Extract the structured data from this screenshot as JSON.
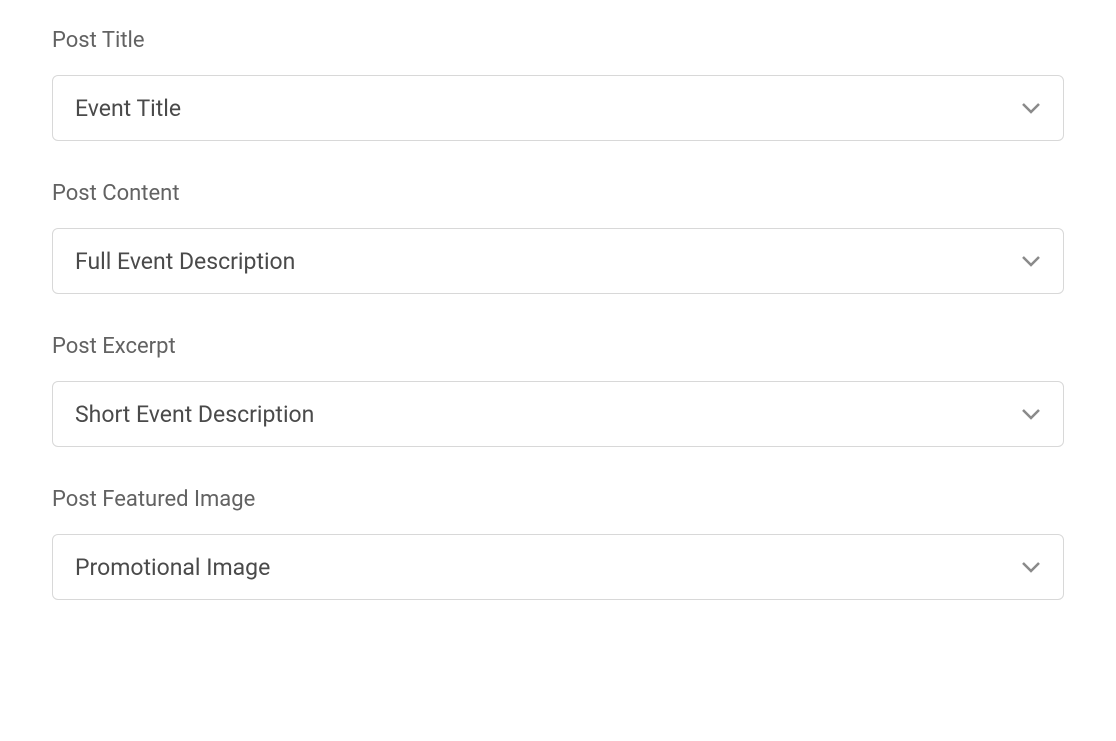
{
  "fields": [
    {
      "label": "Post Title",
      "selected": "Event Title"
    },
    {
      "label": "Post Content",
      "selected": "Full Event Description"
    },
    {
      "label": "Post Excerpt",
      "selected": "Short Event Description"
    },
    {
      "label": "Post Featured Image",
      "selected": "Promotional Image"
    }
  ]
}
